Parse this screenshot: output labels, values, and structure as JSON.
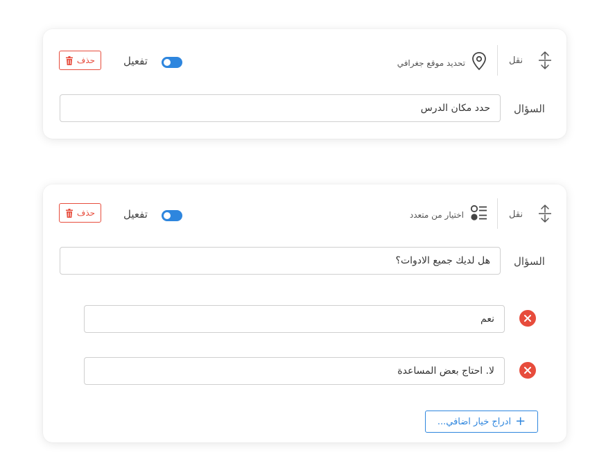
{
  "colors": {
    "accent": "#2e86de",
    "danger": "#e74c3c",
    "border": "#cfcfcf"
  },
  "questions": [
    {
      "move_label": "نقل",
      "move_icon": "move-vertical-icon",
      "type_label": "تحديد موقع جغرافي",
      "type_icon": "location-pin-icon",
      "toggle_label": "تفعيل",
      "toggle_on": true,
      "delete_label": "حذف",
      "delete_icon": "trash-icon",
      "question_label": "السؤال",
      "question_value": "حدد مكان الدرس"
    },
    {
      "move_label": "نقل",
      "move_icon": "move-vertical-icon",
      "type_label": "اختيار من متعدد",
      "type_icon": "multiple-choice-icon",
      "toggle_label": "تفعيل",
      "toggle_on": true,
      "delete_label": "حذف",
      "delete_icon": "trash-icon",
      "question_label": "السؤال",
      "question_value": "هل لديك جميع الادوات؟",
      "options": [
        {
          "value": "نعم",
          "remove_icon": "close-icon"
        },
        {
          "value": "لا. احتاج بعض المساعدة",
          "remove_icon": "close-icon"
        }
      ],
      "add_option_label": "ادراج خيار اضافي...",
      "add_option_icon": "plus-icon"
    }
  ]
}
